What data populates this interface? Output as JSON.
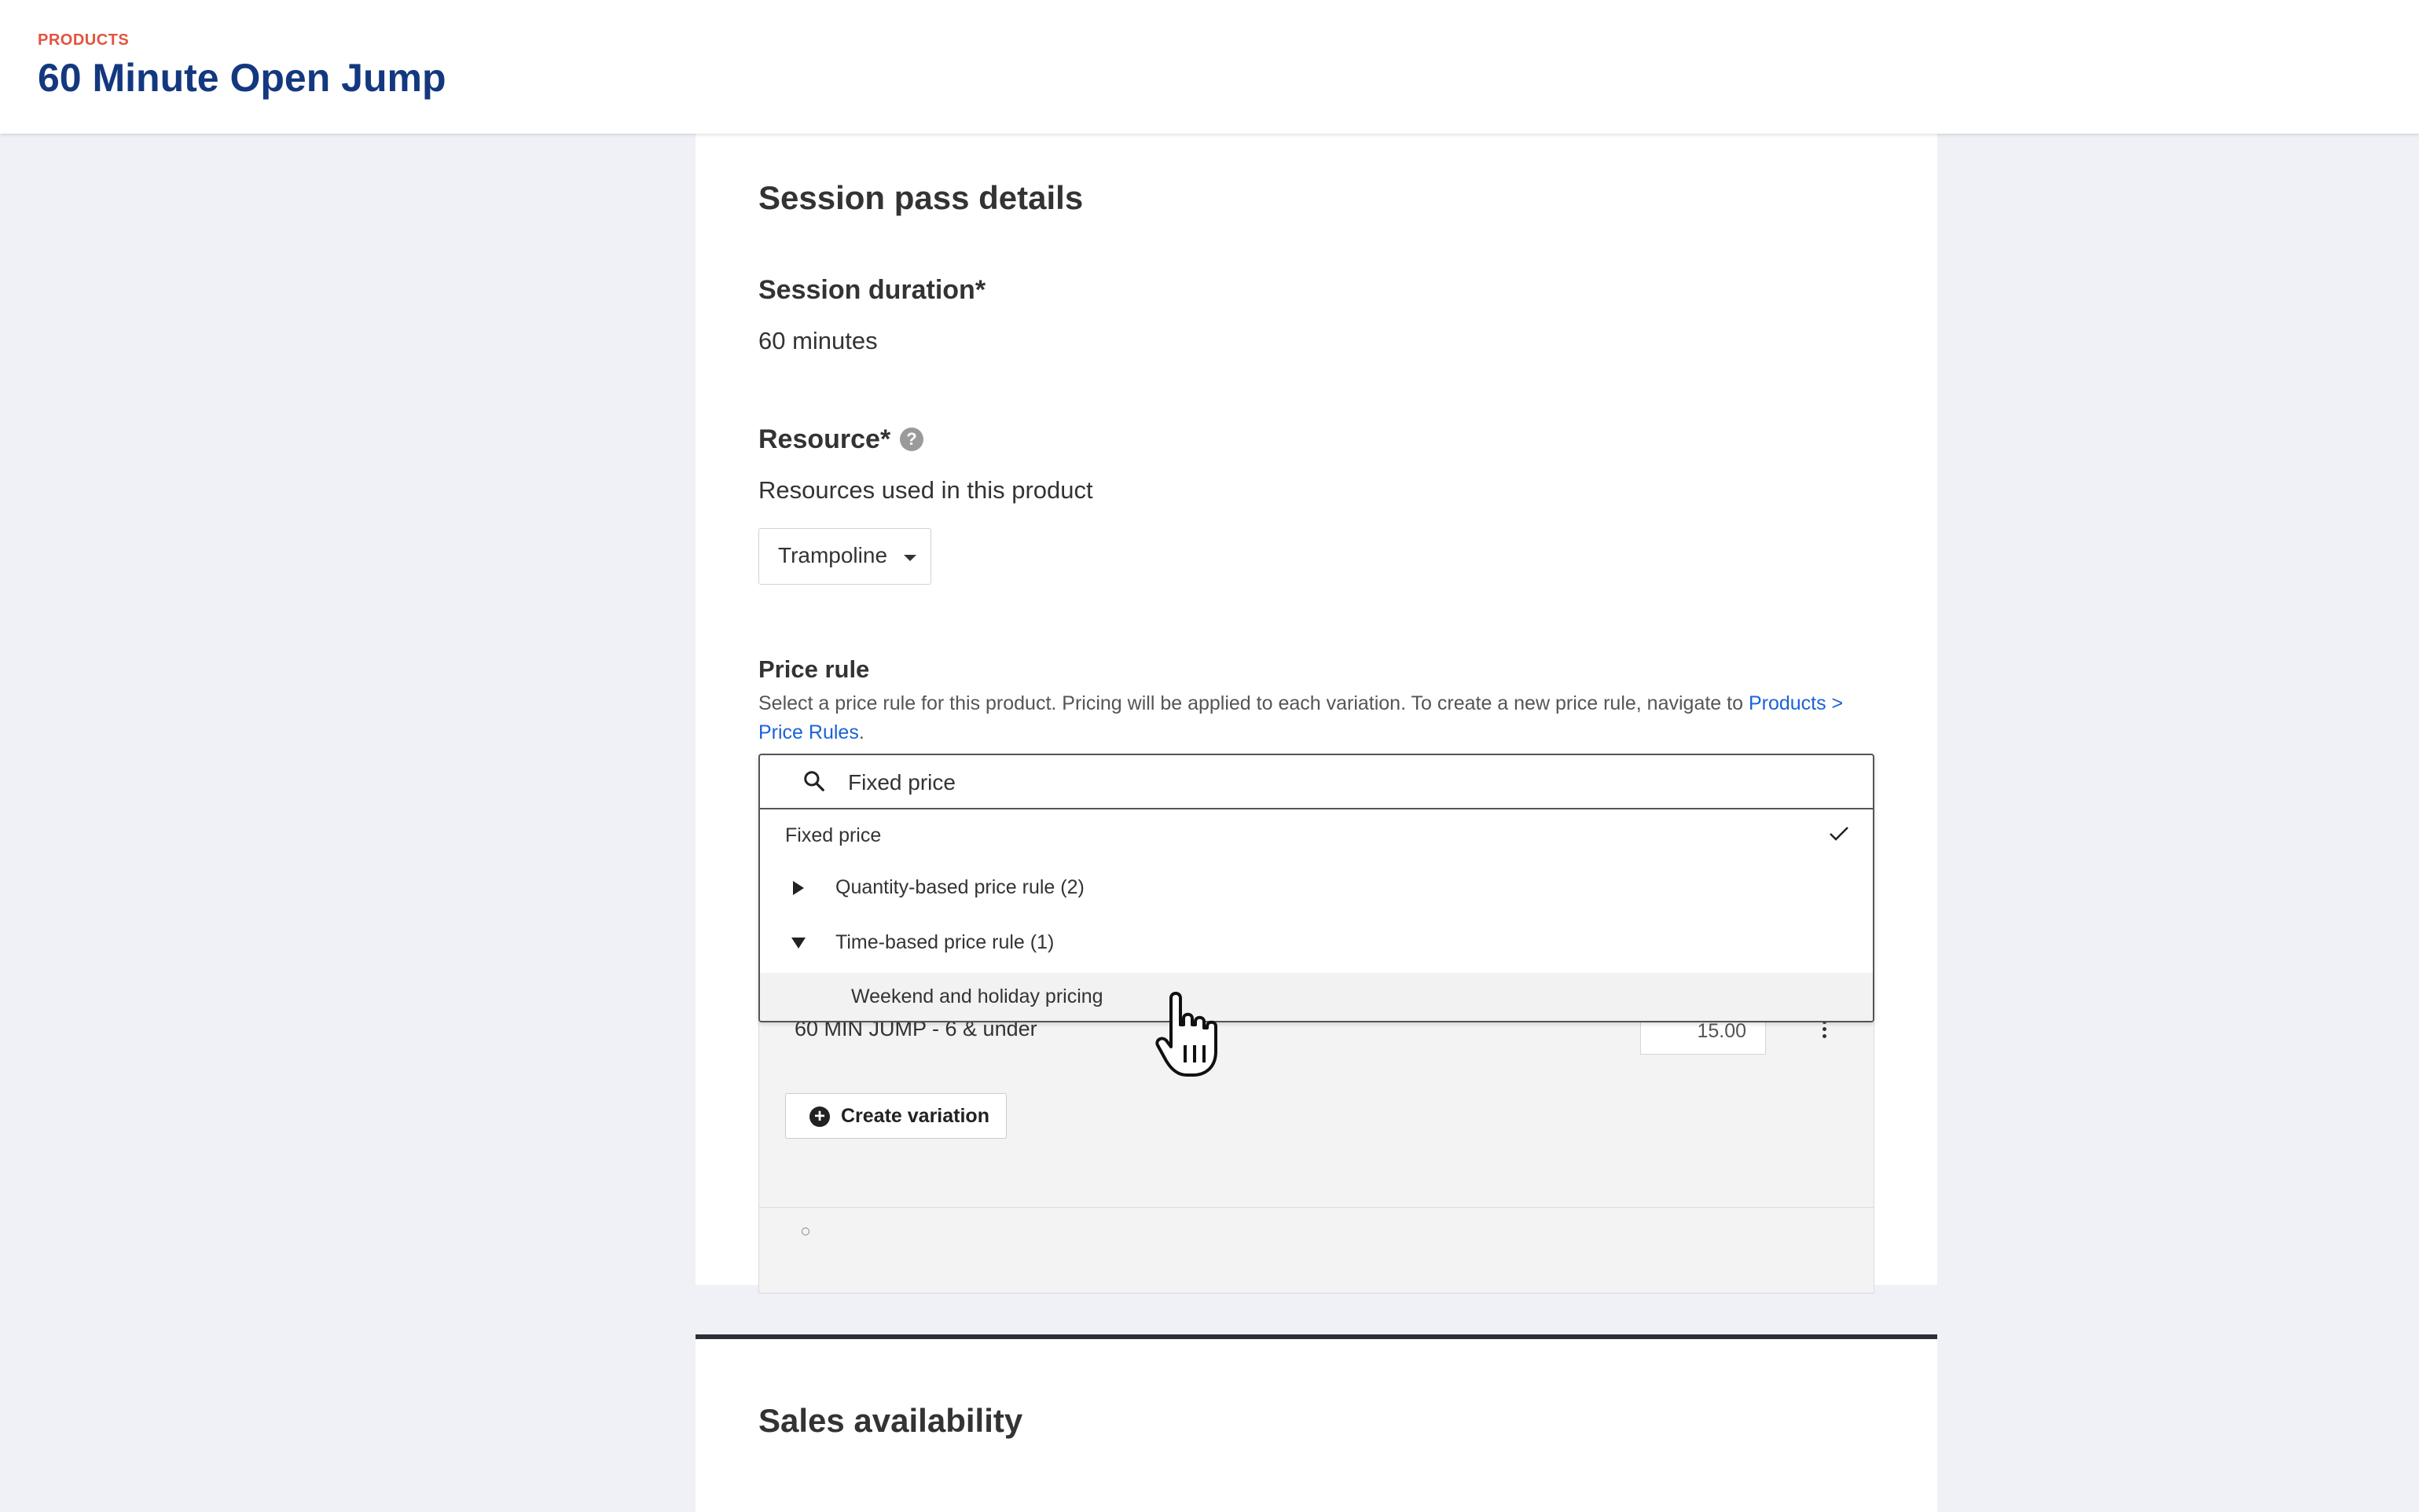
{
  "header": {
    "eyebrow": "PRODUCTS",
    "title": "60 Minute Open Jump"
  },
  "session": {
    "section_title": "Session pass details",
    "duration_label": "Session duration*",
    "duration_value": "60 minutes",
    "resource_label": "Resource*",
    "resource_help_icon": "question-circle-icon",
    "resource_help": "?",
    "resource_sublabel": "Resources used in this product",
    "resource_select_value": "Trampoline"
  },
  "price_rule": {
    "label": "Price rule",
    "description": "Select a price rule for this product. Pricing will be applied to each variation. To create a new price rule, navigate to ",
    "link_text": "Products > Price Rules",
    "description_end": "."
  },
  "dropdown": {
    "search_value": "Fixed price",
    "search_icon": "search-icon",
    "items": [
      {
        "label": "Fixed price",
        "selected": true
      },
      {
        "label": "Quantity-based price rule  (2)",
        "expanded": false
      },
      {
        "label": "Time-based price rule  (1)",
        "expanded": true
      },
      {
        "label": "Weekend and holiday pricing",
        "hovered": true
      }
    ]
  },
  "variations": {
    "row_name": "60 MIN JUMP - 6 & under",
    "row_price": "15.00",
    "create_button": "Create variation",
    "create_icon": "plus-circle-icon"
  },
  "sales": {
    "section_title": "Sales availability"
  }
}
